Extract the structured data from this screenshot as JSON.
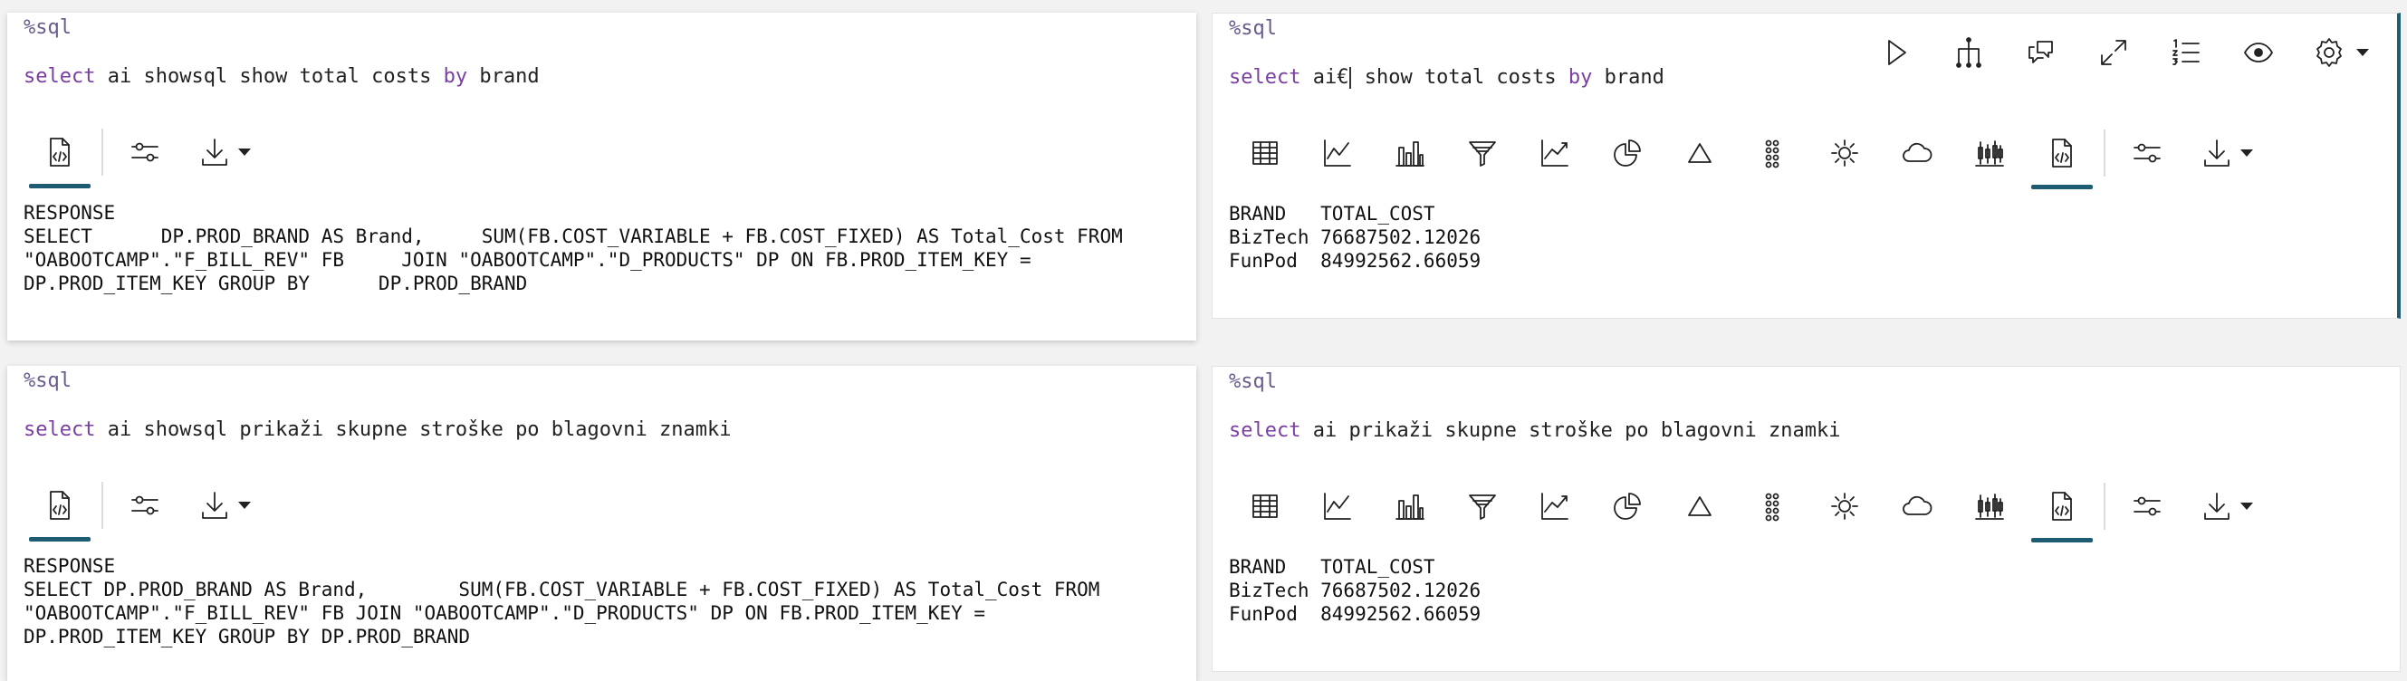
{
  "colors": {
    "keyword": "#7a3fa0",
    "accent": "#1e5c73",
    "interpreter": "#6b5b8c"
  },
  "p1": {
    "interpreter": "%sql",
    "stmt_kw": "select",
    "stmt_mid": " ai showsql show total costs ",
    "stmt_kw2": "by",
    "stmt_end": " brand",
    "output": "RESPONSE\nSELECT      DP.PROD_BRAND AS Brand,     SUM(FB.COST_VARIABLE + FB.COST_FIXED) AS Total_Cost FROM\n\"OABOOTCAMP\".\"F_BILL_REV\" FB     JOIN \"OABOOTCAMP\".\"D_PRODUCTS\" DP ON FB.PROD_ITEM_KEY =\nDP.PROD_ITEM_KEY GROUP BY      DP.PROD_BRAND"
  },
  "p2": {
    "interpreter": "%sql",
    "stmt_kw": "select",
    "stmt_a": " ai€",
    "stmt_mid": " show total costs ",
    "stmt_kw2": "by",
    "stmt_end": " brand",
    "output": "BRAND   TOTAL_COST\nBizTech 76687502.12026\nFunPod  84992562.66059"
  },
  "p3": {
    "interpreter": "%sql",
    "stmt_kw": "select",
    "stmt_mid": " ai showsql prikaži skupne stroške po blagovni znamki",
    "output": "RESPONSE\nSELECT DP.PROD_BRAND AS Brand,        SUM(FB.COST_VARIABLE + FB.COST_FIXED) AS Total_Cost FROM\n\"OABOOTCAMP\".\"F_BILL_REV\" FB JOIN \"OABOOTCAMP\".\"D_PRODUCTS\" DP ON FB.PROD_ITEM_KEY =\nDP.PROD_ITEM_KEY GROUP BY DP.PROD_BRAND"
  },
  "p4": {
    "interpreter": "%sql",
    "stmt_kw": "select",
    "stmt_mid": " ai prikaži skupne stroške po blagovni znamki",
    "output": "BRAND   TOTAL_COST\nBizTech 76687502.12026\nFunPod  84992562.66059"
  },
  "icons": {
    "paragraph_tools": [
      "run-icon",
      "hierarchy-icon",
      "comment-icon",
      "expand-icon",
      "numbered-list-icon",
      "eye-icon",
      "gear-icon"
    ],
    "visualizations": [
      "table-icon",
      "line-chart-icon",
      "bar-chart-icon",
      "funnel-icon",
      "area-chart-icon",
      "pie-chart-icon",
      "triangle-icon",
      "dots-icon",
      "sun-icon",
      "cloud-icon",
      "candlestick-icon",
      "raw-output-icon"
    ]
  }
}
